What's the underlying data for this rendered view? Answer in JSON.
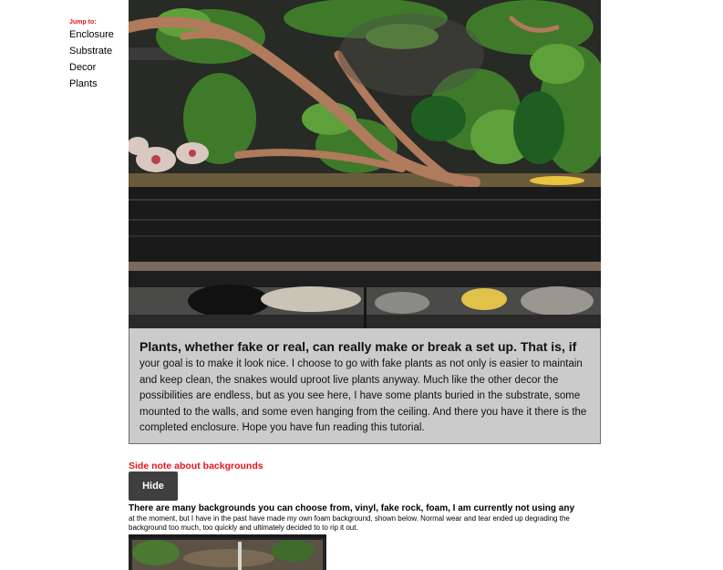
{
  "jump_nav": {
    "title": "Jump to:",
    "links": [
      "Enclosure",
      "Substrate",
      "Decor",
      "Plants"
    ]
  },
  "plants_section": {
    "caption_lead": "Plants, whether fake or real, can really make or break a set up. That is, if",
    "caption_body": "your goal is to make it look nice. I choose to go with fake plants as not only is easier to maintain and keep clean, the snakes would uproot live plants anyway. Much like the other decor the possibilities are endless, but as you see here, I have some plants buried in the substrate, some mounted to the walls, and some even hanging from the ceiling. And there you have it there is the completed enclosure. Hope you have fun reading this tutorial."
  },
  "side_note": {
    "title": "Side note about backgrounds",
    "button_label": "Hide",
    "text_lead": "There are many backgrounds you can choose from, vinyl, fake rock, foam, I am currently not using any",
    "text_body": "at the moment, but I have in the past have made my own foam background, shown below. Normal wear and tear ended up degrading the background too much, too quickly and ultimately decided to to rip it out."
  },
  "colors": {
    "accent_red": "#e4141b",
    "caption_bg": "#cbcbcb",
    "button_bg": "#3f3f3f"
  }
}
